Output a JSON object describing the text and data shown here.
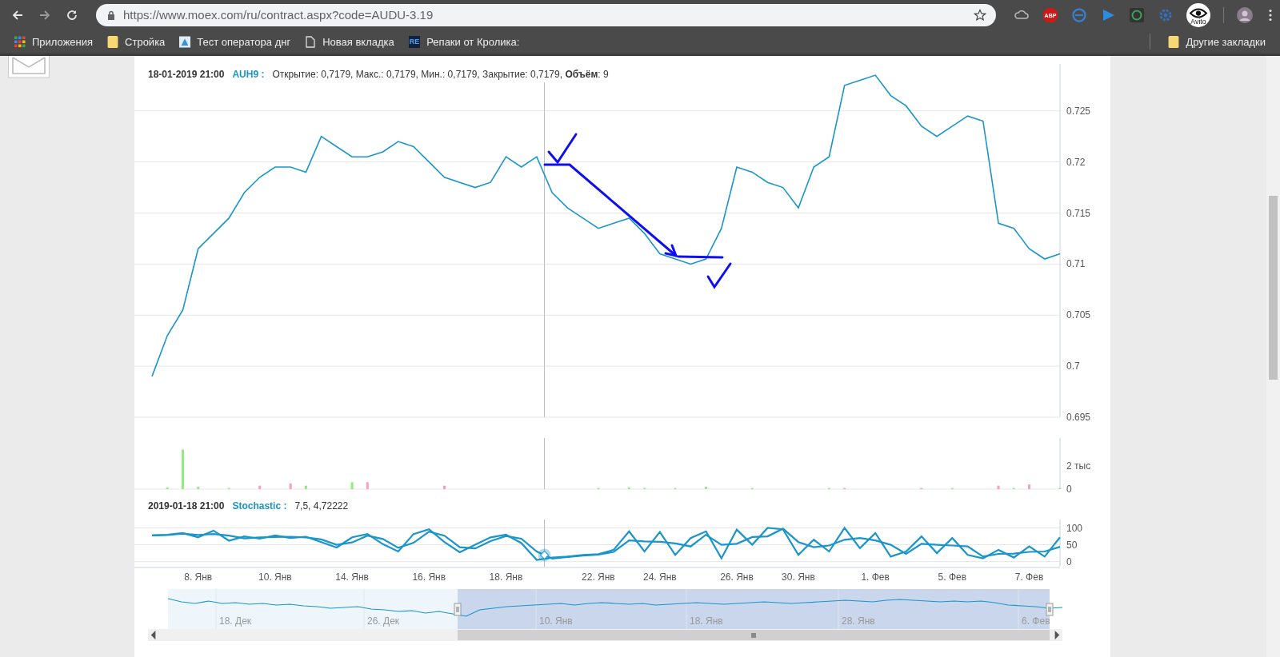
{
  "browser": {
    "url": "https://www.moex.com/ru/contract.aspx?code=AUDU-3.19",
    "abp_label": "ABP",
    "avito_label": "Avito"
  },
  "bookmarks": [
    {
      "label": "Приложения",
      "kind": "apps"
    },
    {
      "label": "Стройка",
      "kind": "folder"
    },
    {
      "label": "Тест оператора днг",
      "kind": "site"
    },
    {
      "label": "Новая вкладка",
      "kind": "page"
    },
    {
      "label": "Репаки от Кролика:",
      "kind": "logo",
      "logo_text": "RE"
    }
  ],
  "other_bookmarks": "Другие закладки",
  "main_chart": {
    "date": "18-01-2019 21:00",
    "symbol": "AUH9 :",
    "details": "Открытие: 0,7179, Макс.: 0,7179, Мин.: 0,7179, Закрытие: 0,7179, **Объём**: 9",
    "chart_data": {
      "type": "line",
      "grid": true,
      "ylim": [
        0.695,
        0.7296
      ],
      "yticks": [
        0.695,
        0.7,
        0.705,
        0.71,
        0.715,
        0.72,
        0.725
      ],
      "series": [
        {
          "color": "#1a95c9",
          "values": [
            0.699,
            0.703,
            0.7055,
            0.7115,
            0.713,
            0.7145,
            0.717,
            0.7185,
            0.7195,
            0.7195,
            0.719,
            0.7225,
            0.7215,
            0.7205,
            0.7205,
            0.721,
            0.722,
            0.7215,
            0.72,
            0.7185,
            0.718,
            0.7175,
            0.718,
            0.7205,
            0.7195,
            0.7205,
            0.717,
            0.7155,
            0.7145,
            0.7135,
            0.714,
            0.7145,
            0.713,
            0.711,
            0.7105,
            0.71,
            0.7105,
            0.7135,
            0.7195,
            0.719,
            0.718,
            0.7175,
            0.7155,
            0.7195,
            0.7205,
            0.7275,
            0.728,
            0.7285,
            0.7265,
            0.7255,
            0.7235,
            0.7225,
            0.7235,
            0.7245,
            0.724,
            0.714,
            0.7135,
            0.7115,
            0.7105,
            0.711
          ]
        }
      ]
    }
  },
  "volume_chart": {
    "chart_data": {
      "type": "bar",
      "stacked": true,
      "ylim": [
        0,
        4.4
      ],
      "yticks": [
        {
          "value": 0,
          "label": "0"
        },
        {
          "value": 2,
          "label": "2 тыс"
        }
      ],
      "series": [
        {
          "color": "#90ed7d",
          "values": [
            0,
            0.15,
            3.4,
            0.2,
            0,
            0.1,
            0,
            0,
            0,
            0,
            0.3,
            0,
            0,
            0.6,
            0,
            0,
            0,
            0,
            0,
            0,
            0,
            0,
            0,
            0,
            0,
            0,
            0,
            0,
            0,
            0.1,
            0,
            0.15,
            0.1,
            0,
            0.1,
            0,
            0.2,
            0,
            0,
            0.1,
            0,
            0,
            0,
            0,
            0.1,
            0,
            0,
            0,
            0,
            0,
            0,
            0,
            0.1,
            0,
            0,
            0,
            0.1,
            0,
            0,
            0.1
          ]
        },
        {
          "color": "#f7a1b5",
          "values": [
            0,
            0,
            0,
            0,
            0,
            0,
            0,
            0.3,
            0,
            0.5,
            0,
            0,
            0,
            0,
            0.6,
            0,
            0,
            0,
            0,
            0.3,
            0,
            0,
            0,
            0,
            0,
            0,
            0,
            0,
            0,
            0,
            0,
            0,
            0,
            0,
            0,
            0,
            0,
            0,
            0,
            0,
            0,
            0,
            0,
            0,
            0,
            0.1,
            0,
            0,
            0,
            0,
            0.1,
            0,
            0,
            0,
            0,
            0.3,
            0,
            0.4,
            0,
            0
          ]
        }
      ]
    }
  },
  "stochastic": {
    "date": "2019-01-18 21:00",
    "name": "Stochastic :",
    "values": "7,5, 4,72222",
    "chart_data": {
      "type": "line",
      "grid": true,
      "ylim": [
        -15,
        125
      ],
      "yticks": [
        0,
        50,
        100
      ],
      "categories": [
        null,
        null,
        null,
        "8. Янв",
        null,
        null,
        null,
        null,
        "10. Янв",
        null,
        null,
        null,
        null,
        "14. Янв",
        null,
        null,
        null,
        null,
        "16. Янв",
        null,
        null,
        null,
        null,
        "18. Янв",
        null,
        null,
        null,
        null,
        null,
        "22. Янв",
        null,
        null,
        null,
        "24. Янв",
        null,
        null,
        null,
        null,
        "26. Янв",
        null,
        null,
        null,
        "30. Янв",
        null,
        null,
        null,
        null,
        "1. Фев",
        null,
        null,
        null,
        null,
        "5. Фев",
        null,
        null,
        null,
        null,
        "7. Фев",
        null,
        null
      ],
      "series": [
        {
          "color": "#1a95c9",
          "values": [
            78,
            80,
            85,
            72,
            92,
            62,
            75,
            68,
            78,
            70,
            74,
            58,
            42,
            72,
            82,
            52,
            30,
            82,
            96,
            58,
            28,
            50,
            72,
            80,
            55,
            5,
            12,
            15,
            20,
            22,
            35,
            90,
            30,
            88,
            20,
            70,
            90,
            10,
            95,
            50,
            100,
            96,
            20,
            65,
            30,
            100,
            40,
            85,
            15,
            30,
            75,
            25,
            70,
            20,
            10,
            35,
            12,
            45,
            15,
            72
          ]
        },
        {
          "color": "#1a95c9",
          "values": [
            78,
            79,
            83,
            79,
            82,
            77,
            69,
            72,
            73,
            74,
            72,
            66,
            50,
            57,
            77,
            67,
            41,
            56,
            89,
            77,
            43,
            39,
            61,
            76,
            68,
            30,
            9,
            14,
            18,
            21,
            29,
            63,
            60,
            59,
            54,
            45,
            80,
            50,
            53,
            73,
            75,
            98,
            58,
            43,
            48,
            65,
            70,
            63,
            50,
            23,
            53,
            50,
            48,
            45,
            15,
            23,
            24,
            29,
            30,
            44
          ]
        }
      ]
    }
  },
  "navigator": {
    "labels": [
      "18. Дек",
      "26. Дек",
      "10. Янв",
      "18. Янв",
      "28. Янв",
      "6. Фев"
    ]
  }
}
